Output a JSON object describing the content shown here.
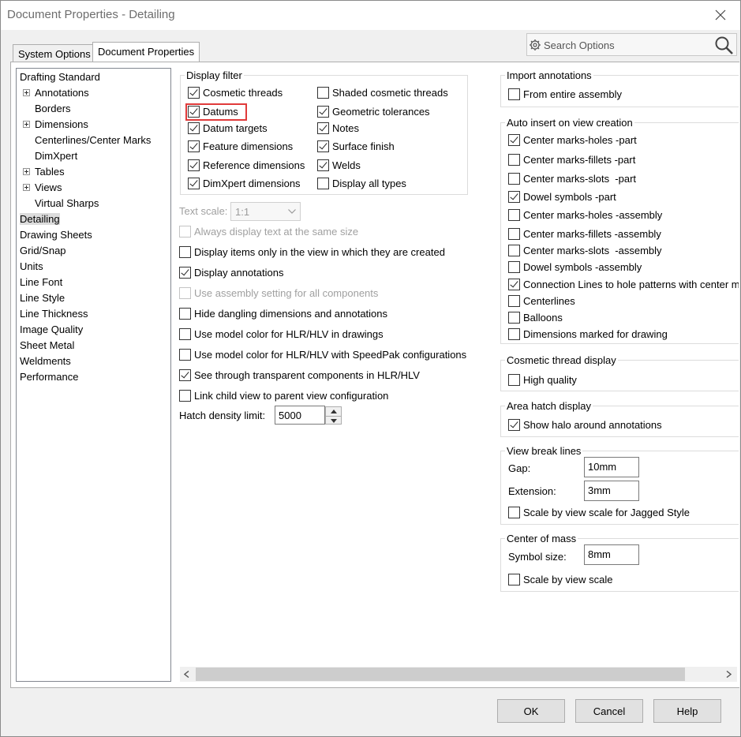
{
  "window": {
    "title": "Document Properties - Detailing"
  },
  "tabs": [
    {
      "label": "System Options"
    },
    {
      "label": "Document Properties"
    }
  ],
  "search": {
    "placeholder": "Search Options"
  },
  "tree": {
    "items": [
      {
        "label": "Drafting Standard"
      },
      {
        "label": "Annotations"
      },
      {
        "label": "Borders"
      },
      {
        "label": "Dimensions"
      },
      {
        "label": "Centerlines/Center Marks"
      },
      {
        "label": "DimXpert"
      },
      {
        "label": "Tables"
      },
      {
        "label": "Views"
      },
      {
        "label": "Virtual Sharps"
      },
      {
        "label": "Detailing"
      },
      {
        "label": "Drawing Sheets"
      },
      {
        "label": "Grid/Snap"
      },
      {
        "label": "Units"
      },
      {
        "label": "Line Font"
      },
      {
        "label": "Line Style"
      },
      {
        "label": "Line Thickness"
      },
      {
        "label": "Image Quality"
      },
      {
        "label": "Sheet Metal"
      },
      {
        "label": "Weldments"
      },
      {
        "label": "Performance"
      }
    ]
  },
  "display_filter": {
    "title": "Display filter",
    "left": [
      {
        "label": "Cosmetic threads",
        "checked": true
      },
      {
        "label": "Datums",
        "checked": true
      },
      {
        "label": "Datum targets",
        "checked": true
      },
      {
        "label": "Feature dimensions",
        "checked": true
      },
      {
        "label": "Reference dimensions",
        "checked": true
      },
      {
        "label": "DimXpert dimensions",
        "checked": true
      }
    ],
    "right": [
      {
        "label": "Shaded cosmetic threads",
        "checked": false
      },
      {
        "label": "Geometric tolerances",
        "checked": true
      },
      {
        "label": "Notes",
        "checked": true
      },
      {
        "label": "Surface finish",
        "checked": true
      },
      {
        "label": "Welds",
        "checked": true
      },
      {
        "label": "Display all types",
        "checked": false
      }
    ]
  },
  "text_scale": {
    "label": "Text scale:",
    "value": "1:1"
  },
  "options": [
    {
      "label": "Always display text at the same size",
      "checked": false,
      "disabled": true
    },
    {
      "label": "Display items only in the view in which they are created",
      "checked": false,
      "disabled": false
    },
    {
      "label": "Display annotations",
      "checked": true,
      "disabled": false
    },
    {
      "label": "Use assembly setting for all components",
      "checked": false,
      "disabled": true
    },
    {
      "label": "Hide dangling dimensions and annotations",
      "checked": false,
      "disabled": false
    },
    {
      "label": "Use model color for HLR/HLV in drawings",
      "checked": false,
      "disabled": false
    },
    {
      "label": "Use model color for HLR/HLV with SpeedPak configurations",
      "checked": false,
      "disabled": false
    },
    {
      "label": "See through transparent components in HLR/HLV",
      "checked": true,
      "disabled": false
    },
    {
      "label": "Link child view to parent view configuration",
      "checked": false,
      "disabled": false
    }
  ],
  "hatch": {
    "label": "Hatch density limit:",
    "value": "5000"
  },
  "import_annotations": {
    "title": "Import annotations",
    "items": [
      {
        "label": "From entire assembly",
        "checked": false
      }
    ]
  },
  "auto_insert": {
    "title": "Auto insert on view creation",
    "items": [
      {
        "label": "Center marks-holes -part",
        "checked": true
      },
      {
        "label": "Center marks-fillets -part",
        "checked": false
      },
      {
        "label": "Center marks-slots  -part",
        "checked": false
      },
      {
        "label": "Dowel symbols -part",
        "checked": true
      },
      {
        "label": "Center marks-holes -assembly",
        "checked": false
      },
      {
        "label": "Center marks-fillets -assembly",
        "checked": false
      },
      {
        "label": "Center marks-slots  -assembly",
        "checked": false
      },
      {
        "label": "Dowel symbols -assembly",
        "checked": false
      },
      {
        "label": "Connection Lines to hole patterns with center m",
        "checked": true
      },
      {
        "label": "Centerlines",
        "checked": false
      },
      {
        "label": "Balloons",
        "checked": false
      },
      {
        "label": "Dimensions marked for drawing",
        "checked": false
      }
    ]
  },
  "cosmetic_thread_display": {
    "title": "Cosmetic thread display",
    "items": [
      {
        "label": "High quality",
        "checked": false
      }
    ]
  },
  "area_hatch_display": {
    "title": "Area hatch display",
    "items": [
      {
        "label": "Show halo around annotations",
        "checked": true
      }
    ]
  },
  "view_break_lines": {
    "title": "View break lines",
    "gap_label": "Gap:",
    "gap_value": "10mm",
    "extension_label": "Extension:",
    "extension_value": "3mm",
    "scale_label": "Scale by view scale for Jagged Style",
    "scale_checked": false
  },
  "center_of_mass": {
    "title": "Center of mass",
    "symbol_label": "Symbol size:",
    "symbol_value": "8mm",
    "scale_label": "Scale by view scale",
    "scale_checked": false
  },
  "buttons": {
    "ok": "OK",
    "cancel": "Cancel",
    "help": "Help"
  },
  "colors": {
    "highlight": "#e03a3a",
    "selected_bg": "#dcdcdc"
  }
}
